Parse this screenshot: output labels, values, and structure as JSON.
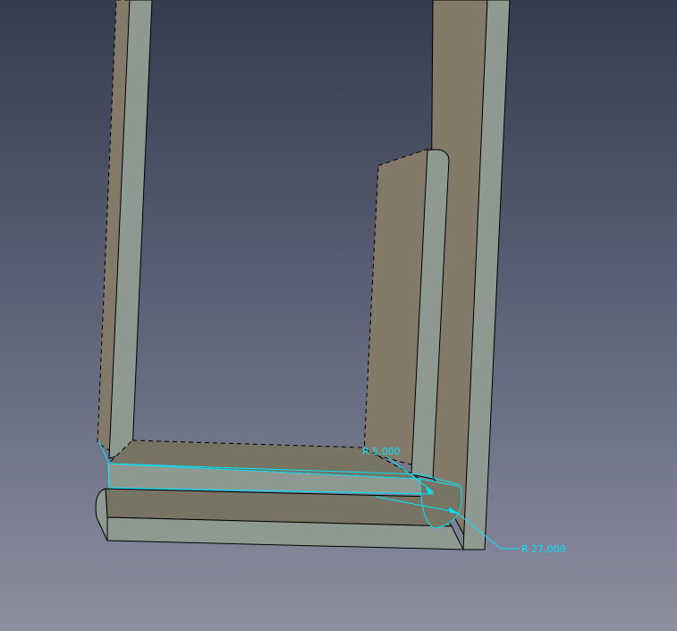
{
  "viewport": {
    "background_top": "#363b4e",
    "background_bottom": "#8d8fa0"
  },
  "colors": {
    "face_dark": "#847a69",
    "face_light": "#8e9a91",
    "face_mid": "#787464",
    "edge": "#000000",
    "highlight": "#00e5ff"
  },
  "dimensions": {
    "inner_radius": {
      "label": "R 5,000"
    },
    "outer_radius": {
      "label": "R 27,000"
    }
  },
  "model": {
    "icon": "sheet-metal-bracket"
  }
}
